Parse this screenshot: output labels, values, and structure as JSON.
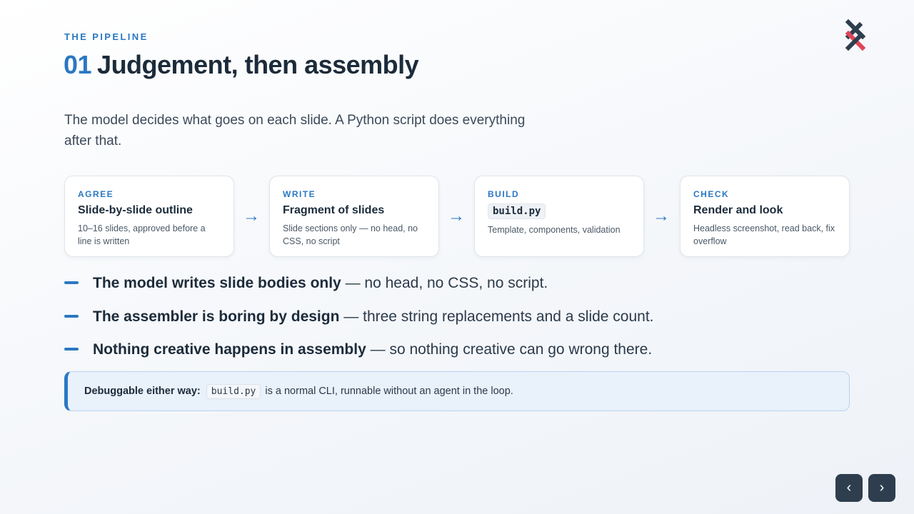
{
  "header": {
    "eyebrow": "THE PIPELINE",
    "number": "01",
    "title": "Judgement, then assembly"
  },
  "lede": "The model decides what goes on each slide. A Python script does everything after that.",
  "steps": [
    {
      "tag": "AGREE",
      "title": "Slide-by-slide outline",
      "desc": "10–16 slides, approved before a line is written"
    },
    {
      "tag": "WRITE",
      "title": "Fragment of slides",
      "desc": "Slide sections only — no head, no CSS, no script"
    },
    {
      "tag": "BUILD",
      "title": "build.py",
      "desc": "Template, components, validation"
    },
    {
      "tag": "CHECK",
      "title": "Render and look",
      "desc": "Headless screenshot, read back, fix overflow"
    }
  ],
  "arrow_glyph": "→",
  "bullets": [
    {
      "bold": "The model writes slide bodies only",
      "rest": " — no head, no CSS, no script."
    },
    {
      "bold": "The assembler is boring by design",
      "rest": " — three string replacements and a slide count."
    },
    {
      "bold": "Nothing creative happens in assembly",
      "rest": " — so nothing creative can go wrong there."
    }
  ],
  "callout": {
    "bold": "Debuggable either way:",
    "code": "build.py",
    "rest": "is a normal CLI, runnable without an agent in the loop."
  },
  "nav": {
    "prev": "‹",
    "next": "›"
  },
  "colors": {
    "accent": "#2b78c2",
    "heading": "#1c2b3a",
    "logo_dark": "#2e3e4e",
    "logo_red": "#e0455a"
  },
  "icons": {
    "logo": "x-logo-icon",
    "arrow": "arrow-right-icon",
    "prev": "chevron-left-icon",
    "next": "chevron-right-icon"
  }
}
